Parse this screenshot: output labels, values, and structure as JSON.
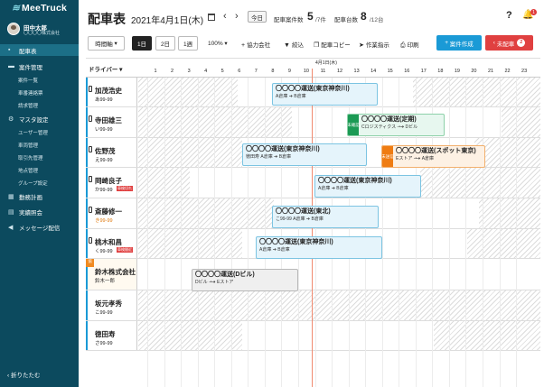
{
  "app": {
    "logo": "MeeTruck",
    "user_name": "田中太郎",
    "user_company": "〇〇〇〇株式会社",
    "fold_label": "折りたたむ"
  },
  "nav": {
    "items": [
      {
        "label": "配車表",
        "icon": "truck-icon",
        "active": true
      },
      {
        "label": "案件管理",
        "icon": "cart-icon",
        "active": false
      },
      {
        "label": "マスタ設定",
        "icon": "gear-icon",
        "active": false
      },
      {
        "label": "勤務計画",
        "icon": "calendar-icon",
        "active": false
      },
      {
        "label": "実績照会",
        "icon": "chart-icon",
        "active": false
      },
      {
        "label": "メッセージ配信",
        "icon": "megaphone-icon",
        "active": false
      }
    ],
    "sub_case": [
      "案件一覧",
      "車番連絡票",
      "請求管理"
    ],
    "sub_master": [
      "ユーザー管理",
      "車両管理",
      "取引先管理",
      "地点管理",
      "グループ設定"
    ]
  },
  "header": {
    "title": "配車表",
    "date": "2021年4月1日(木)",
    "today": "今日",
    "cases_label": "配車案件数",
    "cases_done": "5",
    "cases_total": "/7件",
    "vehicles_label": "配車台数",
    "vehicles_done": "8",
    "vehicles_total": "/12台",
    "help": "?",
    "notifications": "1"
  },
  "toolbar": {
    "interval": "時間軸",
    "range_1": "1日",
    "range_2": "2日",
    "range_3": "1週",
    "zoom": "100%",
    "partner": "協力会社",
    "filter": "絞込",
    "copy": "配車コピー",
    "instruct": "作業指示",
    "print": "印刷",
    "create": "案件作成",
    "unassigned": "未配車",
    "unassigned_count": "2"
  },
  "grid": {
    "driver_header": "ドライバー",
    "day_label": "4月1日(木)",
    "hours": [
      "1",
      "2",
      "3",
      "4",
      "5",
      "6",
      "7",
      "8",
      "9",
      "10",
      "11",
      "12",
      "13",
      "14",
      "15",
      "16",
      "17",
      "18",
      "19",
      "20",
      "21",
      "22",
      "23"
    ],
    "rows": [
      {
        "name": "加茂浩史",
        "plate": "あ99-99",
        "plate_color": "#222",
        "phone": true
      },
      {
        "name": "寺田雄三",
        "plate": "い99-99",
        "plate_color": "#222",
        "phone": true
      },
      {
        "name": "佐野茂",
        "plate": "え99-99",
        "plate_color": "#222",
        "phone": true
      },
      {
        "name": "岡崎良子",
        "plate": "か99-99",
        "plate_color": "#222",
        "phone": true,
        "tag": "車検切れ"
      },
      {
        "name": "斎藤修一",
        "plate": "き99-99",
        "plate_color": "#e07a10",
        "phone": true
      },
      {
        "name": "桃木和昌",
        "plate": "く99-99",
        "plate_color": "#222",
        "phone": true,
        "tag": "車検間近"
      },
      {
        "name": "鈴木株式会社",
        "plate": "鈴木一郎",
        "plate_color": "#222",
        "phone": false,
        "company": "協"
      },
      {
        "name": "坂元孝秀",
        "plate": "こ99-99",
        "plate_color": "#222",
        "phone": false
      },
      {
        "name": "徳田寿",
        "plate": "さ99-99",
        "plate_color": "#222",
        "phone": false
      }
    ]
  },
  "jobs": [
    {
      "title": "〇〇〇〇運送(東京神奈川)",
      "sub": "A倉庫 ➔ B倉庫",
      "color": "blue"
    },
    {
      "title": "〇〇〇〇運送(定期)",
      "sub": "Cロジスティクス -•➔ Dビル",
      "color": "green",
      "tag": "未確認"
    },
    {
      "title": "〇〇〇〇運送(東京神奈川)",
      "sub": "徳田寿 A倉庫 ➔ B倉庫",
      "color": "blue"
    },
    {
      "title": "〇〇〇〇運送(スポット東京)",
      "sub": "Eストア -•➔ A倉庫",
      "color": "orange",
      "tag": "未送信"
    },
    {
      "title": "〇〇〇〇運送(東京神奈川)",
      "sub": "A倉庫 ➔ B倉庫",
      "color": "blue"
    },
    {
      "title": "〇〇〇〇運送(東北)",
      "sub": "こ99-99 A倉庫 ➔ B倉庫",
      "color": "blue"
    },
    {
      "title": "〇〇〇〇運送(東京神奈川)",
      "sub": "A倉庫 ➔ B倉庫",
      "color": "blue"
    },
    {
      "title": "〇〇〇〇運送(Dビル)",
      "sub": "Dビル -•➔ Eストア",
      "color": "gray"
    }
  ]
}
